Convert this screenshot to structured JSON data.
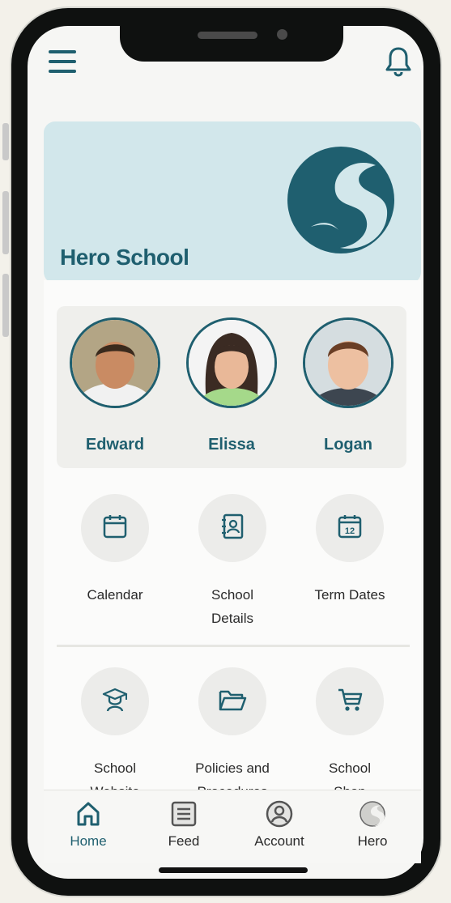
{
  "school": {
    "name": "Hero School"
  },
  "children": [
    {
      "name": "Edward"
    },
    {
      "name": "Elissa"
    },
    {
      "name": "Logan"
    }
  ],
  "tiles": [
    {
      "label": "Calendar",
      "icon": "calendar-icon"
    },
    {
      "label": "School\nDetails",
      "icon": "contact-book-icon"
    },
    {
      "label": "Term Dates",
      "icon": "calendar-12-icon"
    },
    {
      "label": "School\nWebsite",
      "icon": "graduate-icon"
    },
    {
      "label": "Policies and\nProcedures",
      "icon": "folder-icon"
    },
    {
      "label": "School\nShop",
      "icon": "cart-icon"
    }
  ],
  "tabs": [
    {
      "label": "Home",
      "icon": "home-icon",
      "active": true
    },
    {
      "label": "Feed",
      "icon": "feed-icon",
      "active": false
    },
    {
      "label": "Account",
      "icon": "account-icon",
      "active": false
    },
    {
      "label": "Hero",
      "icon": "hero-logo-icon",
      "active": false
    }
  ],
  "colors": {
    "accent": "#1f5f6f",
    "header_bg": "#d2e7eb",
    "tile_bg": "#ececea"
  }
}
